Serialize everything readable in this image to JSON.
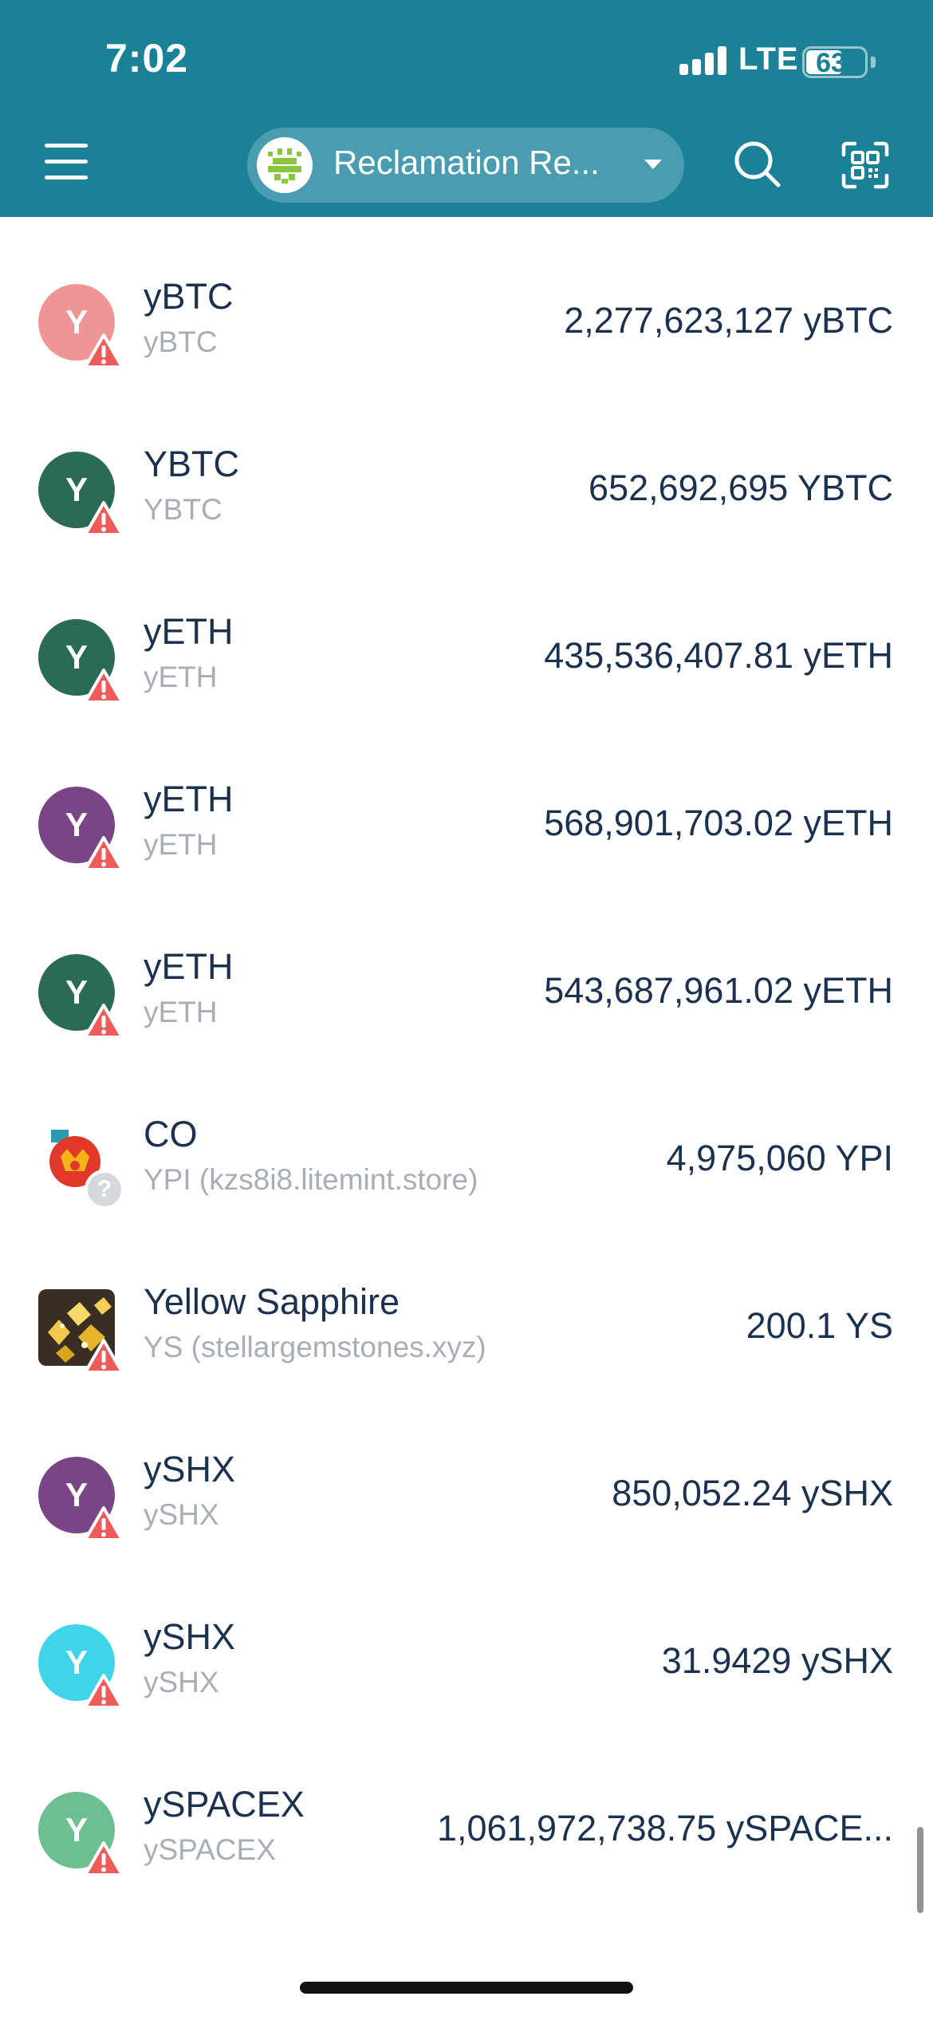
{
  "status_bar": {
    "time": "7:02",
    "network": "LTE",
    "battery": "63",
    "battery_level_percent": 63
  },
  "header": {
    "account_name": "Reclamation Re..."
  },
  "tokens": [
    {
      "name": "yBTC",
      "subtitle": "yBTC",
      "balance": "2,277,623,127 yBTC",
      "icon_letter": "Y",
      "icon_color": "#ee9595",
      "badge": "warning"
    },
    {
      "name": "YBTC",
      "subtitle": "YBTC",
      "balance": "652,692,695 YBTC",
      "icon_letter": "Y",
      "icon_color": "#2b6a56",
      "badge": "warning"
    },
    {
      "name": "yETH",
      "subtitle": "yETH",
      "balance": "435,536,407.81 yETH",
      "icon_letter": "Y",
      "icon_color": "#2b6a56",
      "badge": "warning"
    },
    {
      "name": "yETH",
      "subtitle": "yETH",
      "balance": "568,901,703.02 yETH",
      "icon_letter": "Y",
      "icon_color": "#7a4587",
      "badge": "warning"
    },
    {
      "name": "yETH",
      "subtitle": "yETH",
      "balance": "543,687,961.02 yETH",
      "icon_letter": "Y",
      "icon_color": "#2b6a56",
      "badge": "warning"
    },
    {
      "name": "CO",
      "subtitle": "YPI (kzs8i8.litemint.store)",
      "balance": "4,975,060 YPI",
      "icon_letter": "",
      "icon_color": "#e03a2a",
      "badge": "unknown"
    },
    {
      "name": "Yellow Sapphire",
      "subtitle": "YS (stellargemstones.xyz)",
      "balance": "200.1 YS",
      "icon_letter": "",
      "icon_color": "#c9a23a",
      "badge": "warning"
    },
    {
      "name": "ySHX",
      "subtitle": "ySHX",
      "balance": "850,052.24 ySHX",
      "icon_letter": "Y",
      "icon_color": "#7a4587",
      "badge": "warning"
    },
    {
      "name": "ySHX",
      "subtitle": "ySHX",
      "balance": "31.9429 ySHX",
      "icon_letter": "Y",
      "icon_color": "#3ed4ea",
      "badge": "warning"
    },
    {
      "name": "ySPACEX",
      "subtitle": "ySPACEX",
      "balance": "1,061,972,738.75 ySPACE...",
      "icon_letter": "Y",
      "icon_color": "#6dbf92",
      "badge": "warning"
    }
  ],
  "icons": {
    "menu": "hamburger-menu-icon",
    "search": "search-icon",
    "scan": "qr-scan-icon",
    "dropdown": "chevron-down-icon",
    "warning": "warning-triangle-icon",
    "unknown": "question-mark-icon"
  }
}
